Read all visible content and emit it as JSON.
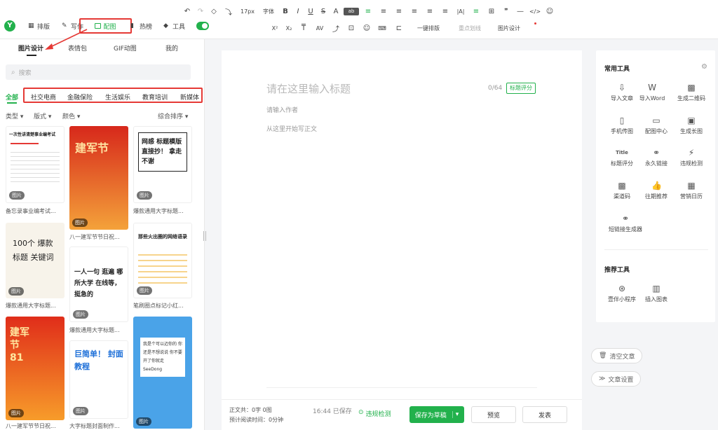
{
  "nav": {
    "logo": "Y",
    "items": [
      "排版",
      "写作",
      "配图",
      "热榜",
      "工具"
    ]
  },
  "toolbar": {
    "row1": [
      "↶",
      "↷",
      "◇",
      "⤵",
      "17px",
      "字体",
      "B",
      "I",
      "U",
      "S",
      "A",
      "ab",
      "≡",
      "≡",
      "≡",
      "≡",
      "≡",
      "≡",
      "|A|",
      "≡",
      "⊞",
      "❞",
      "—",
      "</>",
      "☺"
    ],
    "row2": [
      "X²",
      "X₂",
      "T",
      "AV",
      "⤴",
      "⊡",
      "☺",
      "⌨",
      "⊏",
      "一键排版",
      "重点划线",
      "图片设计"
    ]
  },
  "left": {
    "subtabs": [
      "图片设计",
      "表情包",
      "GIF动图",
      "我的"
    ],
    "search_placeholder": "搜索",
    "categories": [
      "全部",
      "社交电商",
      "金融保险",
      "生活娱乐",
      "教育培训",
      "新媒体"
    ],
    "filters": {
      "type": "类型",
      "layout": "版式",
      "color": "颜色",
      "sort": "综合排序"
    },
    "badge": "图片",
    "cards": [
      {
        "caption": "备忘录事业编考试...",
        "text": "一次性讲清楚事业编考试"
      },
      {
        "caption": "八一建军节节日祝...",
        "text": "建军节"
      },
      {
        "caption": "爆款通用大字标题...",
        "text": "网感 标题模版 直接抄！ 拿走不谢"
      },
      {
        "caption": "爆款通用大字标题...",
        "text": "100个 爆款标题 关键词"
      },
      {
        "caption": "爆款通用大字标题...",
        "text": "一人一句 逛遍 哪所大学 在线等，挺急的"
      },
      {
        "caption": "笔刷圈点标记小红...",
        "text": "那些火出圈的网络语录"
      },
      {
        "caption": "八一建军节节日祝...",
        "text": "建军节 81"
      },
      {
        "caption": "大字标题封面制作...",
        "text": "巨简单！ 封面教程"
      },
      {
        "caption": "",
        "text": "我是个可以迈你的 你还是不想说说 你不要开了你就走 SeeDong"
      }
    ]
  },
  "editor": {
    "title_placeholder": "请在这里输入标题",
    "title_count": "0/64",
    "title_score": "标题评分",
    "author_placeholder": "请输入作者",
    "body_placeholder": "从这里开始写正文"
  },
  "footer": {
    "total": "正文共：0字 0图",
    "read_time": "预计阅读时间：0分钟",
    "saved": "16:44 已保存",
    "violation": "违规检测",
    "save_draft": "保存为草稿",
    "preview": "预览",
    "publish": "发表"
  },
  "right": {
    "common_title": "常用工具",
    "tools": [
      "导入文章",
      "导入Word",
      "生成二维码",
      "手机传图",
      "配图中心",
      "生成长图",
      "标题评分",
      "永久链接",
      "违规检测",
      "渠道码",
      "往期推荐",
      "营销日历",
      "短链接生成器"
    ],
    "recommend_title": "推荐工具",
    "recommend": [
      "壹伴小程序",
      "插入图表"
    ],
    "clear": "清空文章",
    "settings": "文章设置"
  },
  "colors": {
    "accent": "#22b14c",
    "highlight": "#e53935"
  }
}
